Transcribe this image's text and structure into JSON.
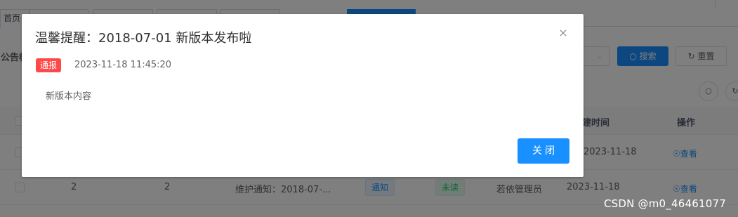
{
  "tabs": [
    {
      "label": "首页"
    },
    {
      "label": ""
    },
    {
      "label": ""
    },
    {
      "label": ""
    },
    {
      "label": ""
    },
    {
      "label": ""
    }
  ],
  "filter": {
    "notice_label": "公告标",
    "search_label": "搜索",
    "reset_label": "重置"
  },
  "table": {
    "headers": {
      "create_time": "建时间",
      "actions": "操作"
    },
    "rows": [
      {
        "create_time": "2023-11-18",
        "action": "查看"
      },
      {
        "id": "2",
        "index": "2",
        "title": "维护通知：2018-07-...",
        "type": "通知",
        "status": "未读",
        "creator": "若依管理员",
        "create_time": "2023-11-18",
        "action": "查看"
      }
    ]
  },
  "watermark": "CSDN @m0_46461077",
  "dialog": {
    "title": "温馨提醒：2018-07-01 新版本发布啦",
    "close_icon": "×",
    "badge": "通报",
    "time": "2023-11-18 11:45:20",
    "content": "新版本内容",
    "close_button": "关闭"
  },
  "colors": {
    "primary": "#1890ff",
    "danger": "#ff4949",
    "success": "#13ce66"
  }
}
